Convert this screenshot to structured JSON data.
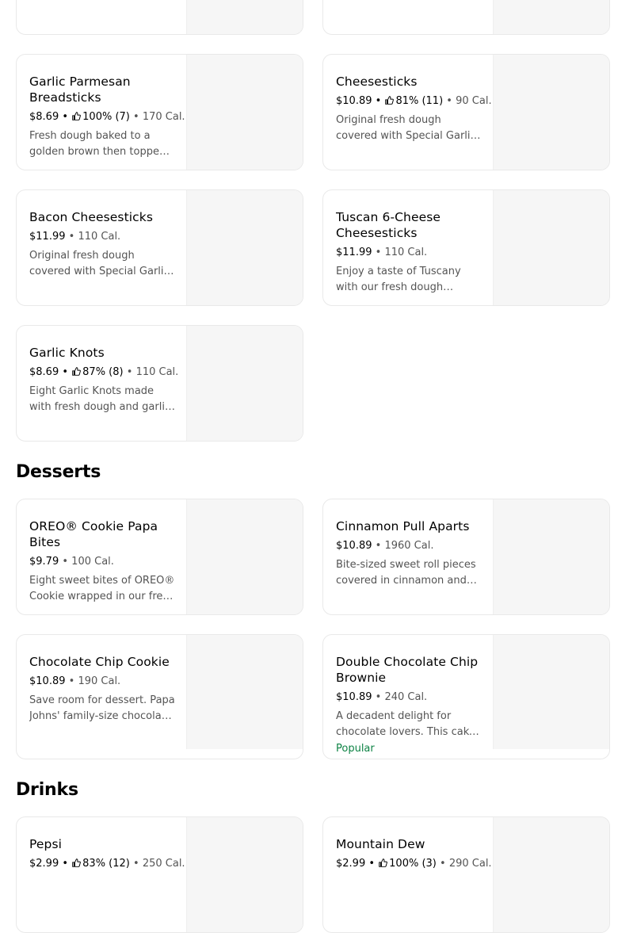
{
  "sections": {
    "desserts": "Desserts",
    "drinks": "Drinks"
  },
  "items": {
    "garlic_parmesan": {
      "name": "Garlic Parmesan Breadsticks",
      "price": "$8.69",
      "rating": "100% (7)",
      "calories": "170 Cal.",
      "description": "Fresh dough baked to a golden brown then topped with garlic parmesan seasoning."
    },
    "cheesesticks": {
      "name": "Cheesesticks",
      "price": "$10.89",
      "rating": "81% (11)",
      "calories": "90 Cal.",
      "description": "Original fresh dough covered with Special Garlic sauce and cheese."
    },
    "bacon_cheesesticks": {
      "name": "Bacon Cheesesticks",
      "price": "$11.99",
      "calories": "110 Cal.",
      "description": "Original fresh dough covered with Special Garlic sauce, cheese and bacon."
    },
    "tuscan_cheesesticks": {
      "name": "Tuscan 6-Cheese Cheesesticks",
      "price": "$11.99",
      "calories": "110 Cal.",
      "description": "Enjoy a taste of Tuscany with our fresh dough topped with six cheeses."
    },
    "garlic_knots": {
      "name": "Garlic Knots",
      "price": "$8.69",
      "rating": "87% (8)",
      "calories": "110 Cal.",
      "description": "Eight Garlic Knots made with fresh dough and garlic parmesan seasoning."
    },
    "oreo_bites": {
      "name": "OREO® Cookie Papa Bites",
      "price": "$9.79",
      "calories": "100 Cal.",
      "description": "Eight sweet bites of OREO® Cookie wrapped in our fresh dough."
    },
    "cinnamon_pull_aparts": {
      "name": "Cinnamon Pull Aparts",
      "price": "$10.89",
      "calories": "1960 Cal.",
      "description": "Bite-sized sweet roll pieces covered in cinnamon and icing."
    },
    "chocolate_chip_cookie": {
      "name": "Chocolate Chip Cookie",
      "price": "$10.89",
      "calories": "190 Cal.",
      "description": "Save room for dessert. Papa Johns' family-size chocolate chip cookie."
    },
    "double_chocolate_brownie": {
      "name": "Double Chocolate Chip Brownie",
      "price": "$10.89",
      "calories": "240 Cal.",
      "description": "A decadent delight for chocolate lovers. This cake-like brownie is loaded with chips.",
      "badge": "Popular"
    },
    "pepsi": {
      "name": "Pepsi",
      "price": "$2.99",
      "rating": "83% (12)",
      "calories": "250 Cal."
    },
    "mountain_dew": {
      "name": "Mountain Dew",
      "price": "$2.99",
      "rating": "100% (3)",
      "calories": "290 Cal."
    }
  },
  "colors": {
    "badge": "#0e8345",
    "muted_text": "#545454",
    "card_border": "#e9e9e9",
    "image_placeholder": "#f6f6f6"
  },
  "icons": {
    "rating": "thumbs-up-icon"
  }
}
